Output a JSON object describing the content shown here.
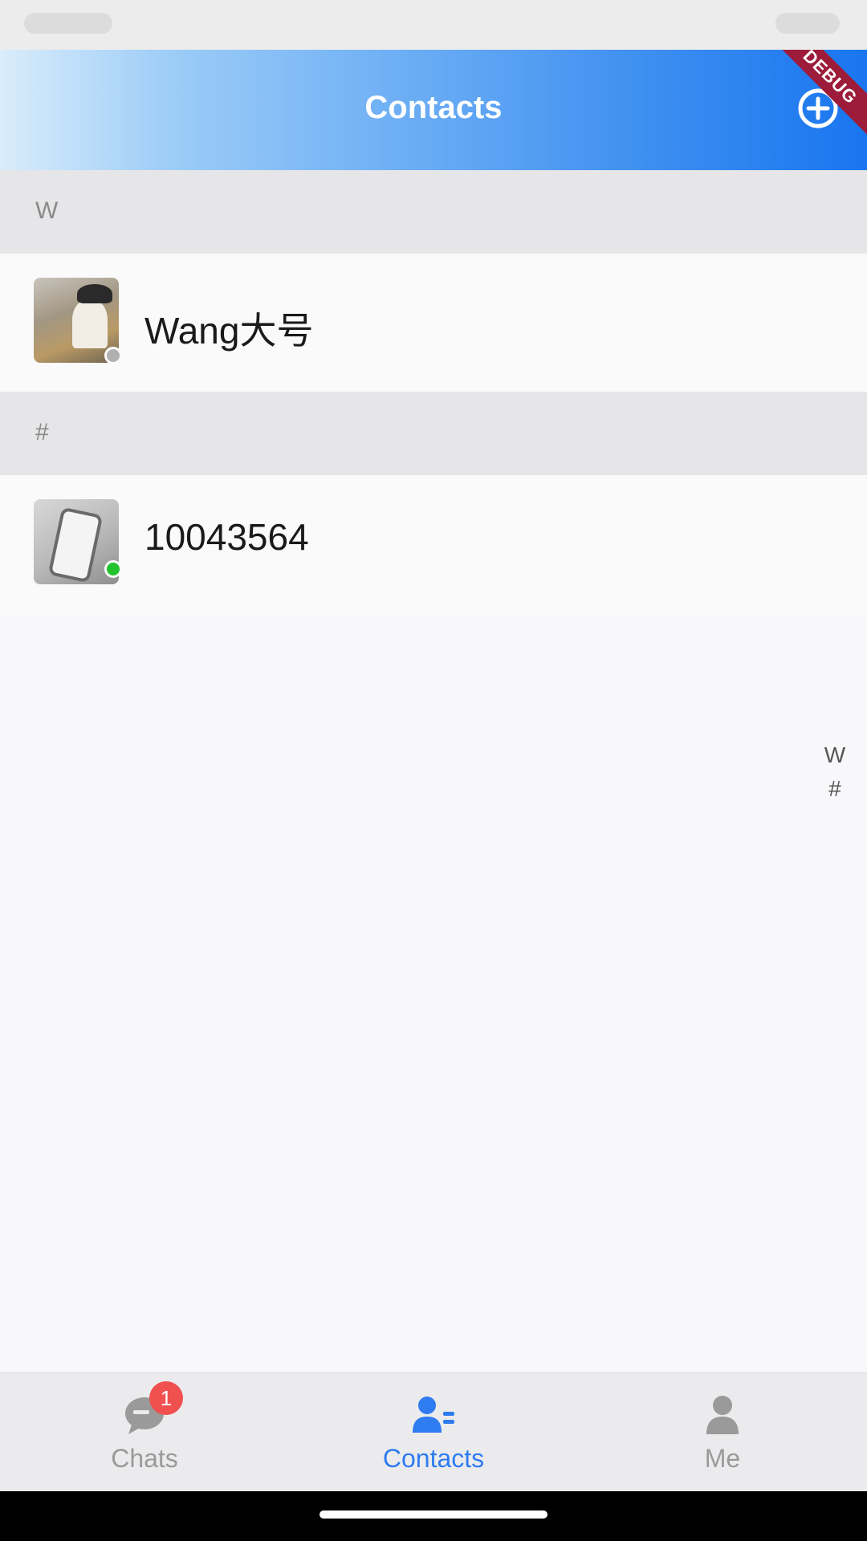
{
  "app_bar": {
    "title": "Contacts",
    "add_icon": "add-circle-icon",
    "debug_banner": "DEBUG"
  },
  "sections": [
    {
      "letter": "W",
      "contacts": [
        {
          "name": "Wang大号",
          "avatar": "photo-person-with-hat",
          "presence_color": "#b0b0b0"
        }
      ]
    },
    {
      "letter": "#",
      "contacts": [
        {
          "name": "10043564",
          "avatar": "photo-hand-with-phone",
          "presence_color": "#22c32e"
        }
      ]
    }
  ],
  "index_bar": [
    "W",
    "#"
  ],
  "bottom_nav": [
    {
      "label": "Chats",
      "icon": "chat-bubble-icon",
      "badge": "1",
      "active": false
    },
    {
      "label": "Contacts",
      "icon": "contacts-list-icon",
      "active": true
    },
    {
      "label": "Me",
      "icon": "person-icon",
      "active": false
    }
  ],
  "colors": {
    "accent": "#2f7bf0",
    "inactive": "#9a9a9a",
    "online": "#22c32e",
    "offline": "#b0b0b0",
    "badge": "#f05050"
  }
}
